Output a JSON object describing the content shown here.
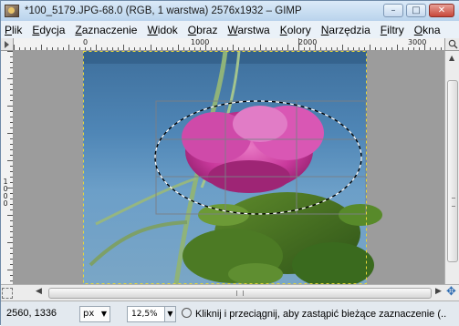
{
  "window": {
    "title": "*100_5179.JPG-68.0 (RGB, 1 warstwa) 2576x1932 – GIMP",
    "minimize_glyph": "–",
    "maximize_glyph": "□",
    "close_glyph": "✕"
  },
  "menu": {
    "items": [
      {
        "underline": "P",
        "rest": "lik"
      },
      {
        "underline": "E",
        "rest": "dycja"
      },
      {
        "underline": "Z",
        "rest": "aznaczenie"
      },
      {
        "underline": "W",
        "rest": "idok"
      },
      {
        "underline": "O",
        "rest": "braz"
      },
      {
        "underline": "W",
        "rest": "arstwa"
      },
      {
        "underline": "K",
        "rest": "olory"
      },
      {
        "underline": "N",
        "rest": "arzędzia"
      },
      {
        "underline": "F",
        "rest": "iltry"
      },
      {
        "underline": "O",
        "rest": "kna"
      }
    ]
  },
  "ruler": {
    "top_labels": [
      "0",
      "1000",
      "2000",
      "3000"
    ],
    "left_label": "1000"
  },
  "scroll": {
    "up_glyph": "▲",
    "down_glyph": "▼",
    "left_glyph": "◀",
    "right_glyph": "▶"
  },
  "status": {
    "coords": "2560, 1336",
    "unit": "px",
    "zoom": "12,5%",
    "message": "Kliknij i przeciągnij, aby zastąpić bieżące zaznaczenie (..."
  },
  "icons": {
    "navigate": "✥",
    "dropdown": "▼"
  }
}
